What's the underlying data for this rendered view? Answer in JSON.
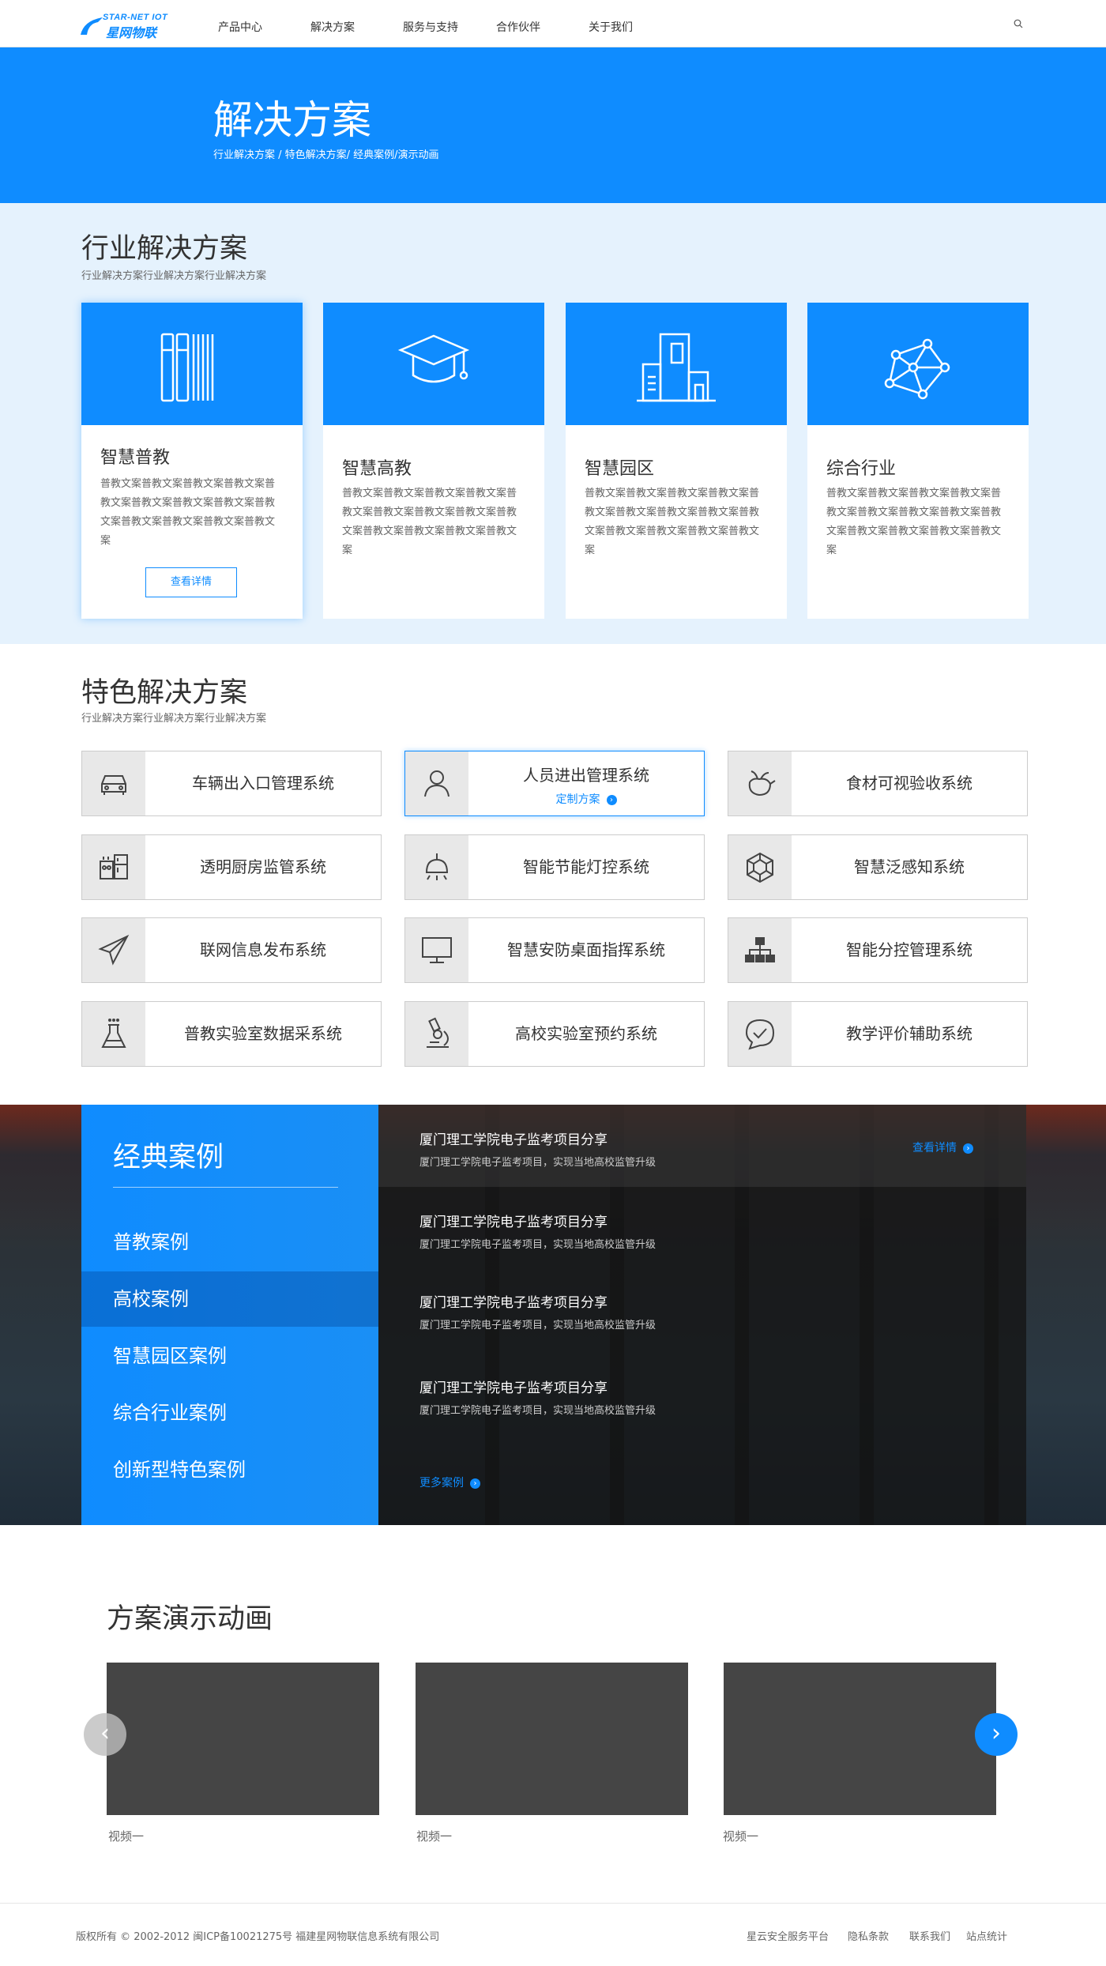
{
  "header": {
    "logo_en": "STAR-NET IOT",
    "logo_cn": "星网物联",
    "nav": [
      "产品中心",
      "解决方案",
      "服务与支持",
      "合作伙伴",
      "关于我们"
    ]
  },
  "banner": {
    "title": "解决方案",
    "subtitle": "行业解决方案 / 特色解决方案/ 经典案例/演示动画"
  },
  "industry": {
    "title": "行业解决方案",
    "subtitle": "行业解决方案行业解决方案行业解决方案",
    "cards": [
      {
        "name": "智慧普教",
        "desc": "普教文案普教文案普教文案普教文案普教文案普教文案普教文案普教文案普教文案普教文案普教文案普教文案普教文案",
        "button": "查看详情"
      },
      {
        "name": "智慧高教",
        "desc": "普教文案普教文案普教文案普教文案普教文案普教文案普教文案普教文案普教文案普教文案普教文案普教文案普教文案"
      },
      {
        "name": "智慧园区",
        "desc": "普教文案普教文案普教文案普教文案普教文案普教文案普教文案普教文案普教文案普教文案普教文案普教文案普教文案"
      },
      {
        "name": "综合行业",
        "desc": "普教文案普教文案普教文案普教文案普教文案普教文案普教文案普教文案普教文案普教文案普教文案普教文案普教文案"
      }
    ]
  },
  "feature": {
    "title": "特色解决方案",
    "subtitle": "行业解决方案行业解决方案行业解决方案",
    "items": [
      {
        "label": "车辆出入口管理系统",
        "icon": "car-icon"
      },
      {
        "label": "人员进出管理系统",
        "icon": "person-icon",
        "link": "定制方案"
      },
      {
        "label": "食材可视验收系统",
        "icon": "vegetable-icon"
      },
      {
        "label": "透明厨房监管系统",
        "icon": "kitchen-icon"
      },
      {
        "label": "智能节能灯控系统",
        "icon": "lamp-icon"
      },
      {
        "label": "智慧泛感知系统",
        "icon": "cube-icon"
      },
      {
        "label": "联网信息发布系统",
        "icon": "send-icon"
      },
      {
        "label": "智慧安防桌面指挥系统",
        "icon": "monitor-icon"
      },
      {
        "label": "智能分控管理系统",
        "icon": "hierarchy-icon"
      },
      {
        "label": "普教实验室数据采系统",
        "icon": "flask-icon"
      },
      {
        "label": "高校实验室预约系统",
        "icon": "microscope-icon"
      },
      {
        "label": "教学评价辅助系统",
        "icon": "chat-check-icon"
      }
    ]
  },
  "cases": {
    "title": "经典案例",
    "tabs": [
      "普教案例",
      "高校案例",
      "智慧园区案例",
      "综合行业案例",
      "创新型特色案例"
    ],
    "items": [
      {
        "title": "厦门理工学院电子监考项目分享",
        "summary": "厦门理工学院电子监考项目，实现当地高校监管升级",
        "link": "查看详情"
      },
      {
        "title": "厦门理工学院电子监考项目分享",
        "summary": "厦门理工学院电子监考项目，实现当地高校监管升级"
      },
      {
        "title": "厦门理工学院电子监考项目分享",
        "summary": "厦门理工学院电子监考项目，实现当地高校监管升级"
      },
      {
        "title": "厦门理工学院电子监考项目分享",
        "summary": "厦门理工学院电子监考项目，实现当地高校监管升级"
      }
    ],
    "more": "更多案例"
  },
  "demo": {
    "title": "方案演示动画",
    "videos": [
      "视频一",
      "视频一",
      "视频一"
    ]
  },
  "footer": {
    "copyright": "版权所有 © 2002-2012 闽ICP备10021275号 福建星网物联信息系统有限公司",
    "links": [
      "星云安全服务平台",
      "隐私条款",
      "联系我们",
      "站点统计"
    ]
  },
  "colors": {
    "accent": "#0f8cff",
    "light_bg": "#e5f2fd",
    "video_bg": "#454545"
  }
}
